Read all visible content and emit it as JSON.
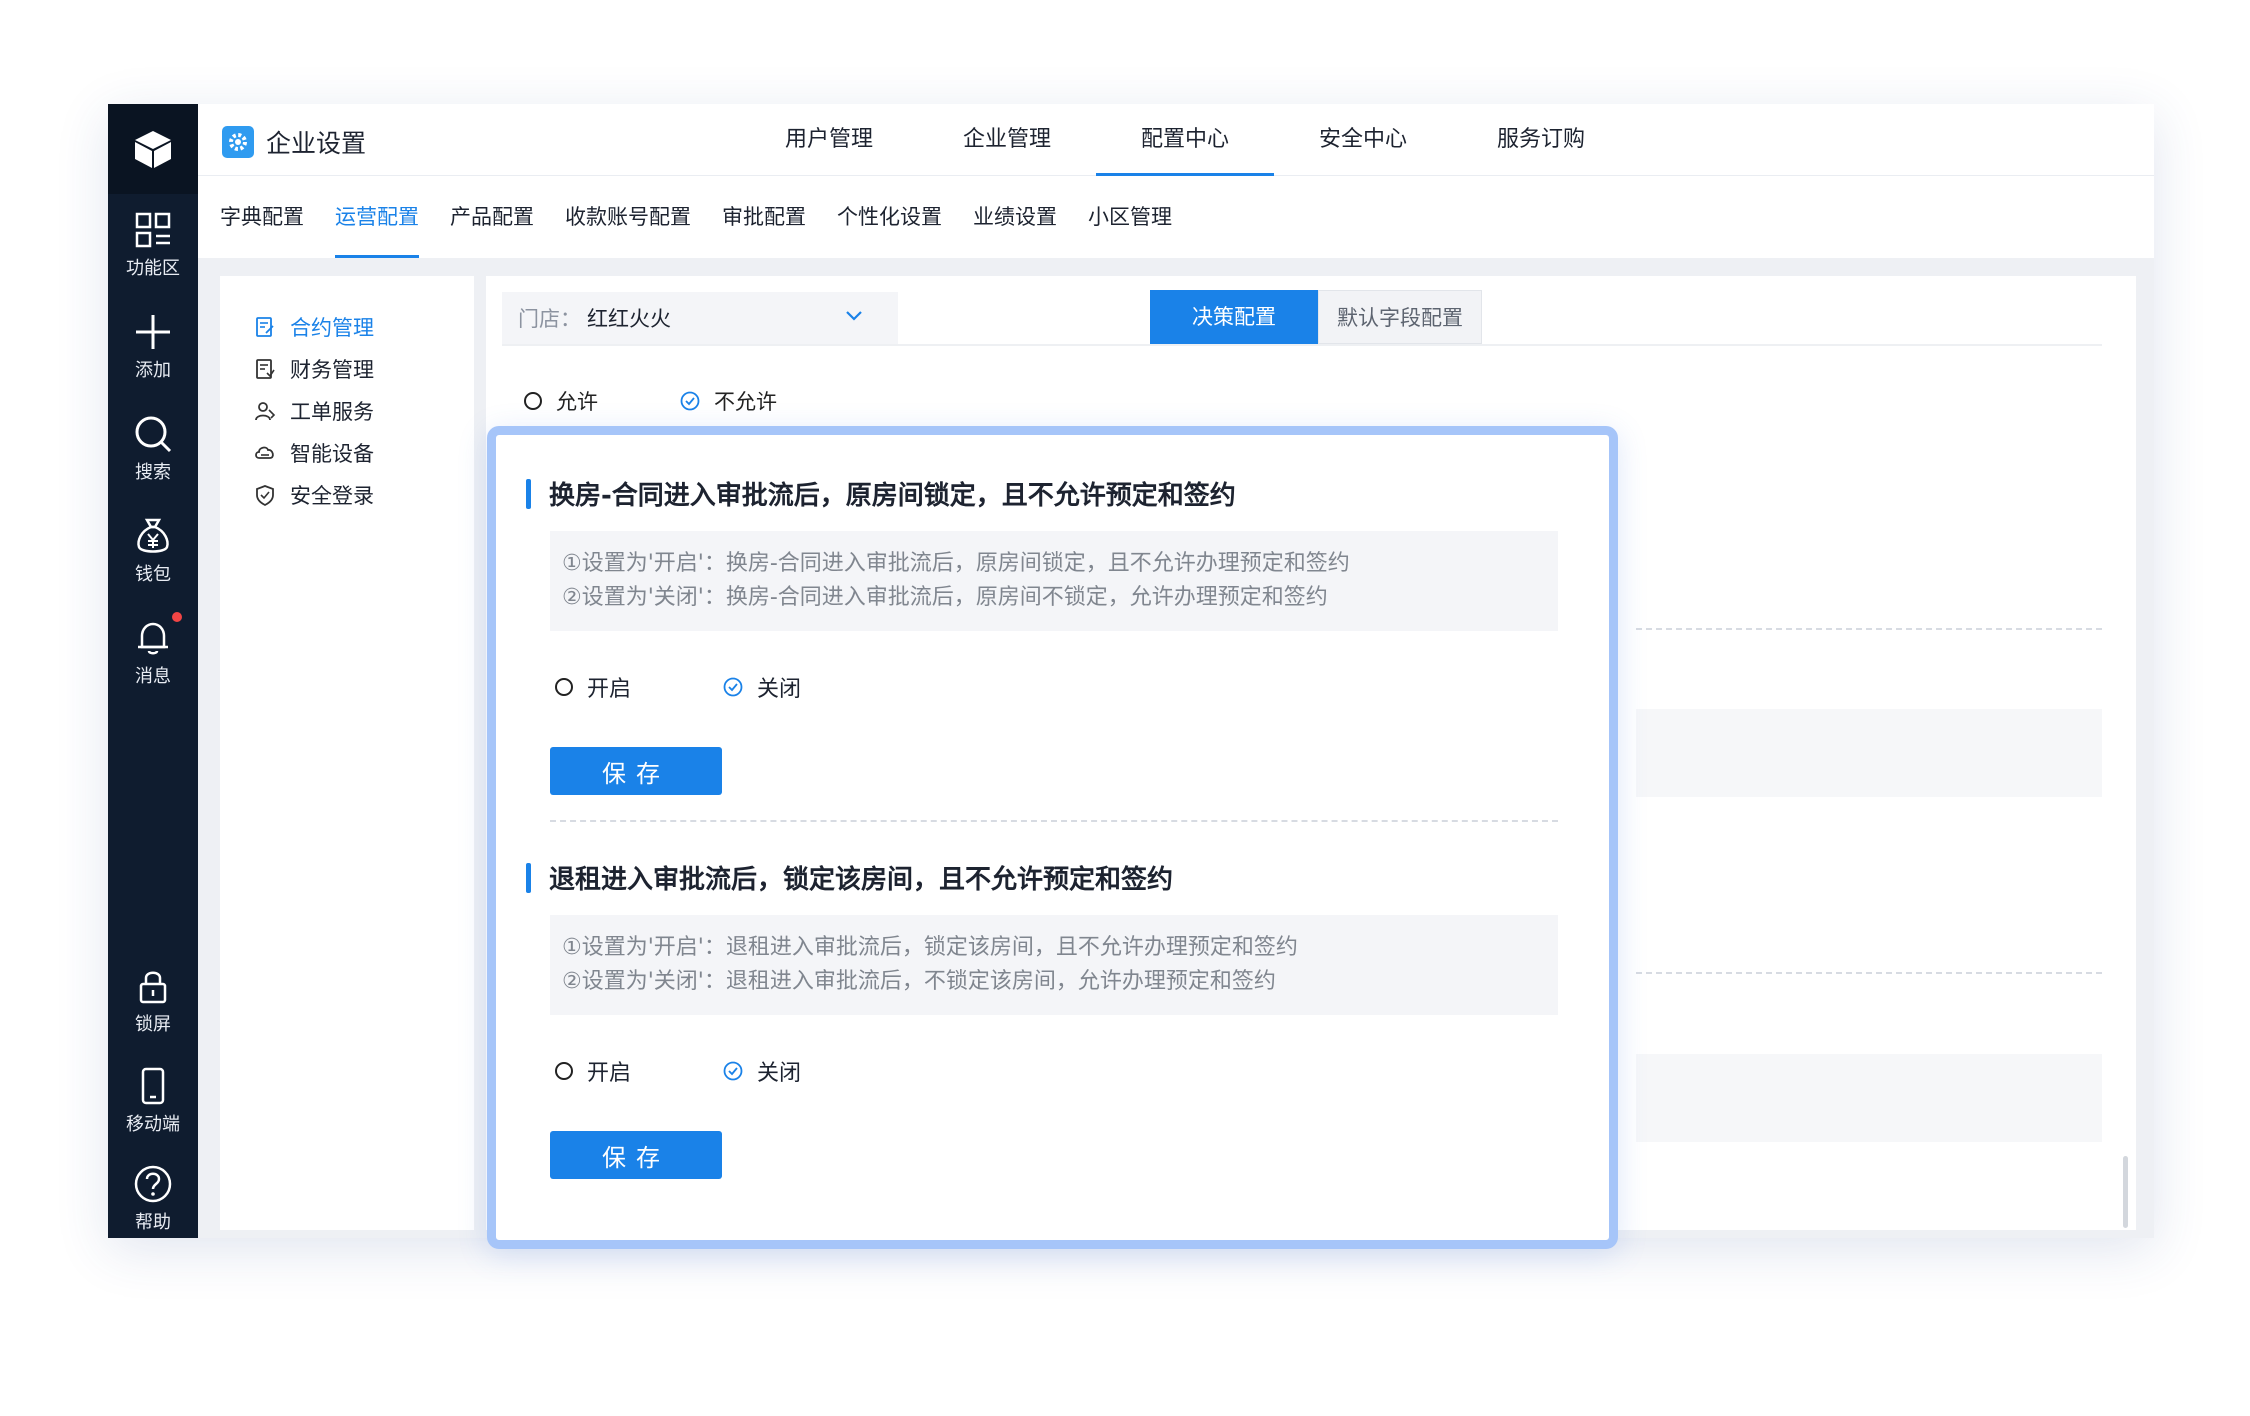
{
  "header": {
    "app_title": "企业设置",
    "nav": [
      "用户管理",
      "企业管理",
      "配置中心",
      "安全中心",
      "服务订购"
    ],
    "active_nav": "配置中心"
  },
  "rail": {
    "items": [
      "功能区",
      "添加",
      "搜索",
      "钱包",
      "消息"
    ],
    "bottom_items": [
      "锁屏",
      "移动端",
      "帮助"
    ]
  },
  "subtabs": {
    "items": [
      "字典配置",
      "运营配置",
      "产品配置",
      "收款账号配置",
      "审批配置",
      "个性化设置",
      "业绩设置",
      "小区管理"
    ],
    "active": "运营配置"
  },
  "leftmenu": {
    "items": [
      "合约管理",
      "财务管理",
      "工单服务",
      "智能设备",
      "安全登录"
    ],
    "active": "合约管理"
  },
  "store": {
    "label": "门店：",
    "value": "红红火火"
  },
  "segment": {
    "active": "决策配置",
    "inactive": "默认字段配置"
  },
  "top_option": {
    "allow": "允许",
    "deny": "不允许",
    "selected": "不允许"
  },
  "sections": [
    {
      "title": "换房-合同进入审批流后，原房间锁定，且不允许预定和签约",
      "desc1": "①设置为'开启'：换房-合同进入审批流后，原房间锁定，且不允许办理预定和签约",
      "desc2": "②设置为'关闭'：换房-合同进入审批流后，原房间不锁定，允许办理预定和签约",
      "on_label": "开启",
      "off_label": "关闭",
      "selected": "关闭",
      "save": "保存"
    },
    {
      "title": "退租进入审批流后，锁定该房间，且不允许预定和签约",
      "desc1": "①设置为'开启'：退租进入审批流后，锁定该房间，且不允许办理预定和签约",
      "desc2": "②设置为'关闭'：退租进入审批流后，不锁定该房间，允许办理预定和签约",
      "on_label": "开启",
      "off_label": "关闭",
      "selected": "关闭",
      "save": "保存"
    }
  ],
  "colors": {
    "accent": "#1a82e8",
    "rail": "#0f1c2f",
    "highlight_border": "#a6c5f9"
  }
}
